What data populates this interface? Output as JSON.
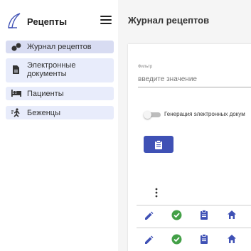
{
  "app": {
    "title": "Рецепты"
  },
  "sidebar": {
    "items": [
      {
        "label": "Журнал рецептов",
        "icon": "people-icon",
        "active": true
      },
      {
        "label": "Электронные документы",
        "icon": "document-icon",
        "active": false
      },
      {
        "label": "Пациенты",
        "icon": "bed-icon",
        "active": false
      },
      {
        "label": "Беженцы",
        "icon": "running-person-icon",
        "active": false
      }
    ]
  },
  "header": {
    "title": "Журнал рецептов"
  },
  "filter": {
    "label": "Фильтр",
    "placeholder": "введите значение",
    "value": ""
  },
  "toggle": {
    "label": "Генерация электронных докум",
    "checked": false
  },
  "table": {
    "row_actions": [
      "edit-icon",
      "check-circle-icon",
      "clipboard-icon",
      "home-icon"
    ],
    "rows": [
      {
        "actions": [
          "edit",
          "check",
          "clipboard",
          "home"
        ]
      },
      {
        "actions": [
          "edit",
          "check",
          "clipboard",
          "home"
        ]
      }
    ]
  },
  "colors": {
    "primary": "#3f51b5",
    "success": "#43a047",
    "nav_bg": "#e8ecfb",
    "nav_active_bg": "#d8dcf2",
    "main_bg": "#f5f5f5"
  }
}
